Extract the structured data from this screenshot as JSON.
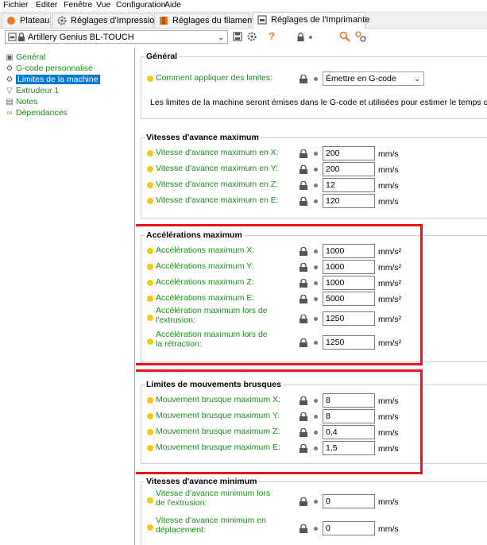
{
  "menu": [
    "Fichier",
    "Editer",
    "Fenêtre",
    "Vue",
    "Configuration",
    "Aide"
  ],
  "tabs": [
    {
      "label": "Plateau",
      "icon": "plater-icon"
    },
    {
      "label": "Réglages d'Impression",
      "icon": "gear-icon"
    },
    {
      "label": "Réglages du filament",
      "icon": "filament-icon"
    },
    {
      "label": "Réglages de l'Imprimante",
      "icon": "printer-icon"
    }
  ],
  "toolbar": {
    "printer_name": "Artillery Genius BL-TOUCH"
  },
  "sidebar": [
    {
      "label": "Général",
      "icon": "general-icon"
    },
    {
      "label": "G-code personnalisé",
      "icon": "gcode-icon"
    },
    {
      "label": "Limites de la machine",
      "icon": "limits-icon",
      "selected": true
    },
    {
      "label": "Extrudeur 1",
      "icon": "extruder-icon"
    },
    {
      "label": "Notes",
      "icon": "notes-icon"
    },
    {
      "label": "Dépendances",
      "icon": "dependencies-icon"
    }
  ],
  "general": {
    "title": "Général",
    "apply_label": "Comment appliquer des limites:",
    "apply_value": "Émettre en G-code",
    "note": "Les limites de la machine seront émises dans le G-code et utilisées pour estimer le temps d'impres"
  },
  "feed": {
    "title": "Vitesses d'avance maximum",
    "rows": [
      {
        "label": "Vitesse d'avance maximum en X:",
        "value": "200",
        "unit": "mm/s"
      },
      {
        "label": "Vitesse d'avance maximum en Y:",
        "value": "200",
        "unit": "mm/s"
      },
      {
        "label": "Vitesse d'avance maximum en Z:",
        "value": "12",
        "unit": "mm/s"
      },
      {
        "label": "Vitesse d'avance maximum en E:",
        "value": "120",
        "unit": "mm/s"
      }
    ]
  },
  "accel": {
    "title": "Accélérations maximum",
    "rows": [
      {
        "label": "Accélérations maximum X:",
        "value": "1000",
        "unit": "mm/s²"
      },
      {
        "label": "Accélérations maximum Y:",
        "value": "1000",
        "unit": "mm/s²"
      },
      {
        "label": "Accélérations maximum Z:",
        "value": "1000",
        "unit": "mm/s²"
      },
      {
        "label": "Accélérations maximum E:",
        "value": "5000",
        "unit": "mm/s²"
      },
      {
        "label": "Accélération maximum lors de l'extrusion:",
        "value": "1250",
        "unit": "mm/s²"
      },
      {
        "label": "Accélération maximum lors de la rétraction:",
        "value": "1250",
        "unit": "mm/s²"
      }
    ]
  },
  "jerk": {
    "title": "Limites de mouvements brusques",
    "rows": [
      {
        "label": "Mouvement brusque maximum X:",
        "value": "8",
        "unit": "mm/s"
      },
      {
        "label": "Mouvement brusque maximum Y:",
        "value": "8",
        "unit": "mm/s"
      },
      {
        "label": "Mouvement brusque maximum Z:",
        "value": "0,4",
        "unit": "mm/s"
      },
      {
        "label": "Mouvement brusque maximum E:",
        "value": "1,5",
        "unit": "mm/s"
      }
    ]
  },
  "minfeed": {
    "title": "Vitesses d'avance minimum",
    "rows": [
      {
        "label": "Vitesse d'avance minimum lors de l'extrusion:",
        "value": "0",
        "unit": "mm/s"
      },
      {
        "label": "Vitesse d'avance minimum en déplacement:",
        "value": "0",
        "unit": "mm/s"
      }
    ]
  },
  "colors": {
    "highlight": "#e8141b",
    "selection": "#0078d7",
    "label_green": "#1a8a1a",
    "indicator": "#f6c90e"
  }
}
